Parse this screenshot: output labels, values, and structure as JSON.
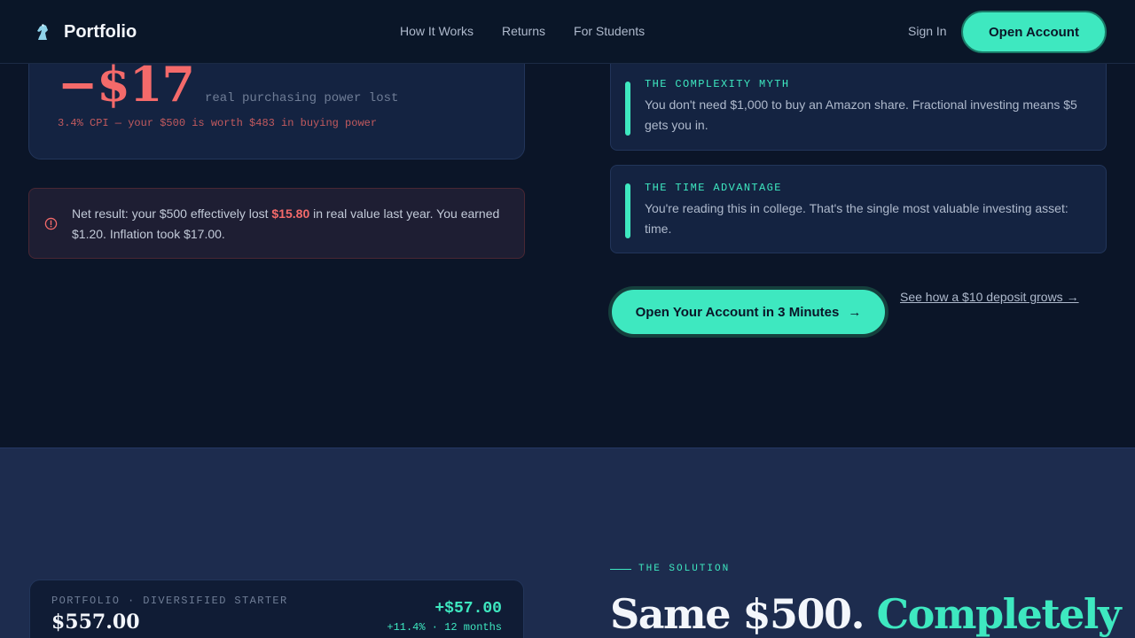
{
  "nav": {
    "brand": "Portfolio",
    "logo_icon": "chess-knight-icon",
    "links": [
      "How It Works",
      "Returns",
      "For Students"
    ],
    "sign_in": "Sign In",
    "open_account": "Open Account"
  },
  "loss_card": {
    "amount": "−$17",
    "label": "real purchasing power lost",
    "sub": "3.4% CPI — your $500 is worth $483 in buying power"
  },
  "alert": {
    "icon": "alert-circle-icon",
    "text_before": "Net result: your $500 effectively lost ",
    "highlight": "$15.80",
    "text_after": " in real value last year. You earned $1.20. Inflation took $17.00."
  },
  "myths": [
    {
      "title": "THE COMPLEXITY MYTH",
      "body": "You don't need $1,000 to buy an Amazon share. Fractional investing means $5 gets you in."
    },
    {
      "title": "THE TIME ADVANTAGE",
      "body": "You're reading this in college. That's the single most valuable investing asset: time."
    }
  ],
  "cta": {
    "button": "Open Your Account in 3 Minutes",
    "arrow": "→",
    "link": "See how a $10 deposit grows →"
  },
  "portfolio": {
    "label": "PORTFOLIO · DIVERSIFIED STARTER",
    "value": "$557.00",
    "gain": "+$57.00",
    "gain_sub": "+11.4% · 12 months"
  },
  "solution": {
    "tag": "THE SOLUTION",
    "headline_plain": "Same $500. ",
    "headline_accent": "Completely"
  },
  "colors": {
    "accent": "#3ee8c0",
    "loss": "#f46a6a",
    "background": "#0b1528"
  }
}
